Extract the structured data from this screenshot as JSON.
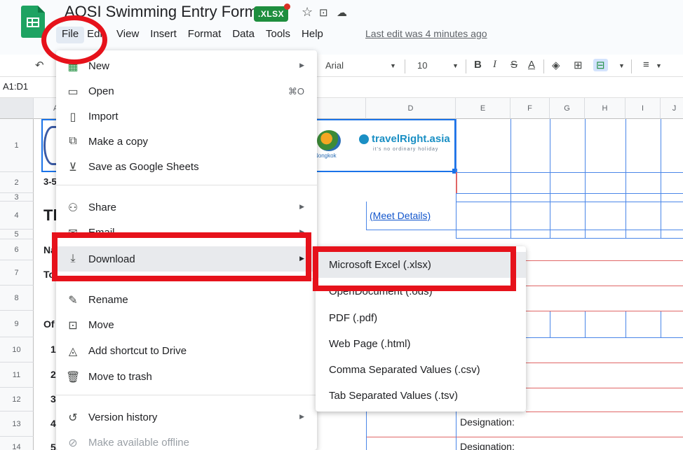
{
  "header": {
    "title": "AOSI Swimming Entry Form",
    "badge": ".XLSX",
    "last_edit": "Last edit was 4 minutes ago",
    "menu": [
      "File",
      "Edit",
      "View",
      "Insert",
      "Format",
      "Data",
      "Tools",
      "Help"
    ]
  },
  "toolbar": {
    "font": "Arial",
    "font_size": "10",
    "bold": "B",
    "italic": "I",
    "strike": "S",
    "text_color": "A"
  },
  "formula_bar": {
    "name_box": "A1:D1"
  },
  "grid": {
    "columns": [
      "A",
      "D",
      "E",
      "F",
      "G",
      "H",
      "I",
      "J"
    ],
    "rows": [
      "1",
      "2",
      "3",
      "4",
      "5",
      "6",
      "7",
      "8",
      "9",
      "10",
      "11",
      "12",
      "13",
      "14"
    ],
    "cells": {
      "r2": "3-5",
      "r4": "Th",
      "r6": "Na",
      "r7": "To",
      "r9": "Of",
      "r10": "1",
      "r11": "2",
      "r12": "3",
      "r13": "4",
      "r14": "5",
      "meet_details": "(Meet Details)",
      "designation_13": "Designation:",
      "designation_14": "Designation:",
      "logo_brand": "travelRight.asia",
      "logo_tagline": "it's no ordinary holiday",
      "logo_left": "Nongkok"
    }
  },
  "file_menu": {
    "items": [
      {
        "label": "New",
        "icon": "new-sheet-icon"
      },
      {
        "label": "Open",
        "icon": "folder-icon",
        "shortcut": "⌘O"
      },
      {
        "label": "Import",
        "icon": "file-icon"
      },
      {
        "label": "Make a copy",
        "icon": "copy-icon"
      },
      {
        "label": "Save as Google Sheets",
        "icon": "save-icon"
      },
      {
        "label": "Share",
        "icon": "share-person-icon"
      },
      {
        "label": "Email",
        "icon": "email-icon"
      },
      {
        "label": "Download",
        "icon": "download-icon"
      },
      {
        "label": "Rename",
        "icon": "pencil-icon"
      },
      {
        "label": "Move",
        "icon": "move-folder-icon"
      },
      {
        "label": "Add shortcut to Drive",
        "icon": "drive-shortcut-icon"
      },
      {
        "label": "Move to trash",
        "icon": "trash-icon"
      },
      {
        "label": "Version history",
        "icon": "history-icon"
      },
      {
        "label": "Make available offline",
        "icon": "offline-icon"
      }
    ]
  },
  "download_menu": {
    "items": [
      "Microsoft Excel (.xlsx)",
      "OpenDocument (.ods)",
      "PDF (.pdf)",
      "Web Page (.html)",
      "Comma Separated Values (.csv)",
      "Tab Separated Values (.tsv)"
    ]
  },
  "colors": {
    "annotation_red": "#e6121b",
    "badge_green": "#1e8e3e",
    "link_blue": "#1155cc"
  }
}
